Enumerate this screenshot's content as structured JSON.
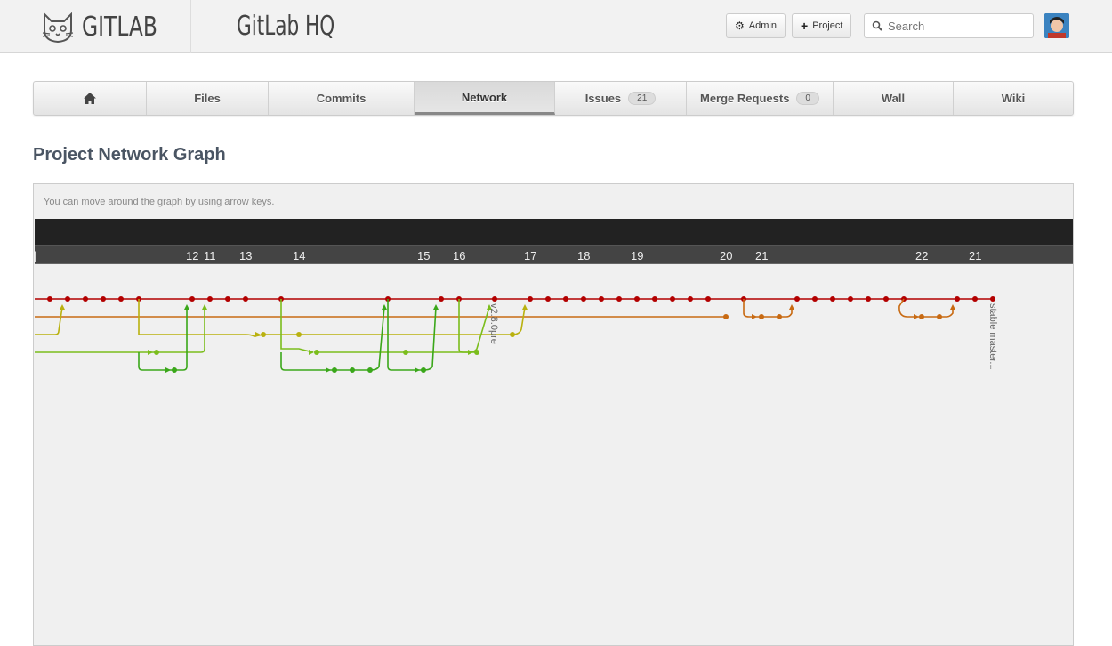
{
  "header": {
    "logo_text": "GITLAB",
    "project_name": "GitLab HQ",
    "admin_label": "Admin",
    "project_label": "Project",
    "search_placeholder": "Search"
  },
  "tabs": [
    {
      "label": "",
      "icon": "home-icon"
    },
    {
      "label": "Files"
    },
    {
      "label": "Commits"
    },
    {
      "label": "Network",
      "active": true
    },
    {
      "label": "Issues",
      "count": "21"
    },
    {
      "label": "Merge Requests",
      "count": "0"
    },
    {
      "label": "Wall"
    },
    {
      "label": "Wiki"
    }
  ],
  "page": {
    "title": "Project Network Graph",
    "hint": "You can move around the graph by using arrow keys."
  },
  "graph": {
    "days": [
      "12",
      "11",
      "13",
      "14",
      "15",
      "16",
      "17",
      "18",
      "19",
      "20",
      "21",
      "22",
      "21"
    ],
    "refs": [
      "v2.8.0pre",
      "stable master..."
    ],
    "colors": {
      "branch1": "#b30000",
      "branch2": "#c86a12",
      "branch3": "#b9b10f",
      "branch4": "#7bbd1c",
      "branch5": "#3aa71a"
    }
  }
}
